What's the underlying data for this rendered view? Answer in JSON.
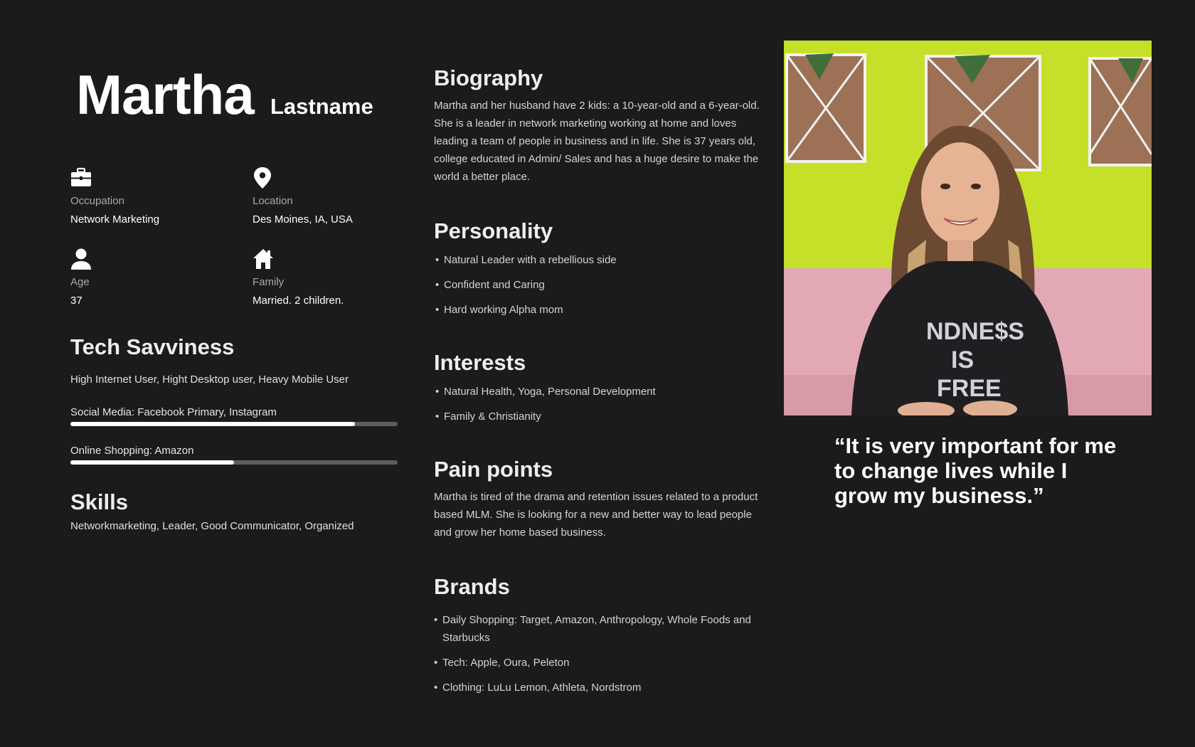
{
  "persona": {
    "first_name": "Martha",
    "last_name": "Lastname"
  },
  "info": {
    "occupation": {
      "label": "Occupation",
      "value": "Network Marketing",
      "icon": "briefcase-icon"
    },
    "location": {
      "label": "Location",
      "value": "Des Moines, IA, USA",
      "icon": "map-pin-icon"
    },
    "age": {
      "label": "Age",
      "value": "37",
      "icon": "person-icon"
    },
    "family": {
      "label": "Family",
      "value": "Married. 2 children.",
      "icon": "home-icon"
    }
  },
  "tech": {
    "title": "Tech Savviness",
    "summary": "High Internet User, Hight Desktop user, Heavy Mobile User",
    "bars": [
      {
        "label": "Social Media: Facebook Primary, Instagram",
        "level": 0.87
      },
      {
        "label": "Online Shopping: Amazon",
        "level": 0.5
      }
    ]
  },
  "skills": {
    "title": "Skills",
    "text": "Networkmarketing, Leader, Good Communicator, Organized"
  },
  "biography": {
    "title": "Biography",
    "text": "Martha and her husband have 2 kids: a 10-year-old and a 6-year-old. She is a leader in network marketing working at home and loves leading a team of people in business and in life. She is 37 years old, college educated in Admin/ Sales and has a huge desire to make the world a better place."
  },
  "personality": {
    "title": "Personality",
    "items": [
      "Natural Leader with a rebellious side",
      "Confident and Caring",
      "Hard working Alpha mom"
    ]
  },
  "interests": {
    "title": "Interests",
    "items": [
      "Natural Health, Yoga, Personal Development",
      "Family & Christianity"
    ]
  },
  "pain_points": {
    "title": "Pain points",
    "text": "Martha is tired of the drama and retention issues related to a product based MLM. She is looking for a new and better way to lead people and grow her home based business."
  },
  "brands": {
    "title": "Brands",
    "items": [
      "Daily Shopping: Target, Amazon, Anthropology, Whole Foods and Starbucks",
      "Tech: Apple, Oura, Peleton",
      "Clothing: LuLu Lemon, Athleta, Nordstrom"
    ]
  },
  "quote": "“It is very important for me to change lives while I grow my business.”",
  "colors": {
    "background": "#1b1b1b",
    "wall": "#c9e326",
    "couch": "#e3a8b4",
    "bar_fill": "#ffffff",
    "bar_track": "#5e5e5e"
  }
}
